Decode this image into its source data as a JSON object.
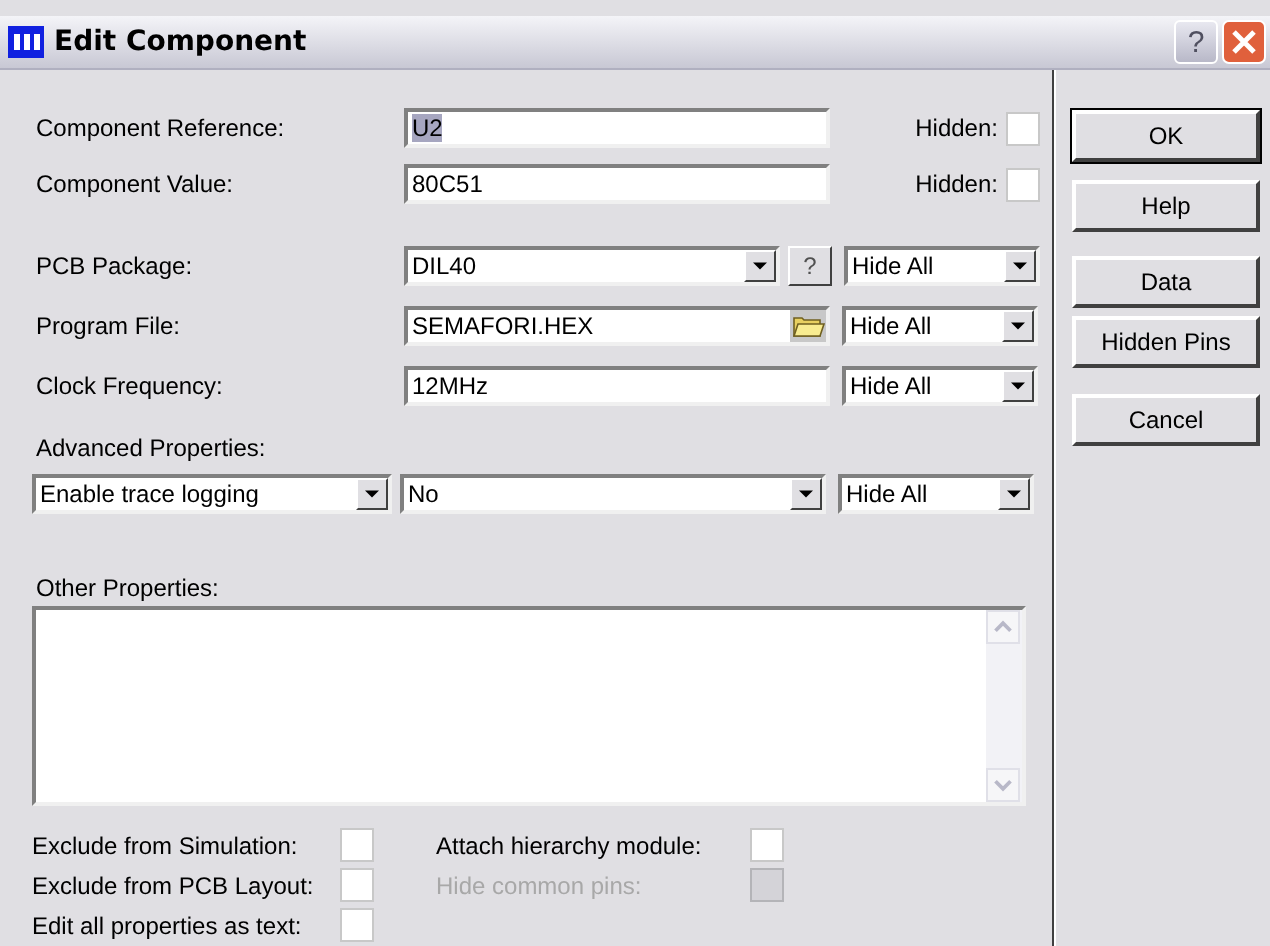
{
  "window": {
    "title": "Edit Component",
    "help_button": "?"
  },
  "fields": [
    {
      "label": "Component Reference:",
      "value": "U2",
      "text_selected": true,
      "hidden_label": "Hidden:",
      "hidden": false
    },
    {
      "label": "Component Value:",
      "value": "80C51",
      "text_selected": false,
      "hidden_label": "Hidden:",
      "hidden": false
    }
  ],
  "properties": [
    {
      "label": "PCB Package:",
      "kind": "select",
      "value": "DIL40",
      "button": "?",
      "visibility": "Hide All"
    },
    {
      "label": "Program File:",
      "kind": "file",
      "value": "SEMAFORI.HEX",
      "visibility": "Hide All"
    },
    {
      "label": "Clock Frequency:",
      "kind": "text",
      "value": "12MHz",
      "visibility": "Hide All"
    }
  ],
  "advanced": {
    "label": "Advanced Properties:",
    "property": "Enable trace logging",
    "value": "No",
    "visibility": "Hide All"
  },
  "other": {
    "label": "Other Properties:"
  },
  "options_left": [
    {
      "label": "Exclude from Simulation:",
      "checked": false,
      "disabled": false
    },
    {
      "label": "Exclude from PCB Layout:",
      "checked": false,
      "disabled": false
    },
    {
      "label": "Edit all properties as text:",
      "checked": false,
      "disabled": false
    }
  ],
  "options_right": [
    {
      "label": "Attach hierarchy module:",
      "checked": false,
      "disabled": false
    },
    {
      "label": "Hide common pins:",
      "checked": false,
      "disabled": true
    }
  ],
  "buttons": [
    {
      "label": "OK",
      "default": true
    },
    {
      "label": "Help",
      "default": false
    },
    {
      "label": "Data",
      "default": false
    },
    {
      "label": "Hidden Pins",
      "default": false
    },
    {
      "label": "Cancel",
      "default": false
    }
  ]
}
